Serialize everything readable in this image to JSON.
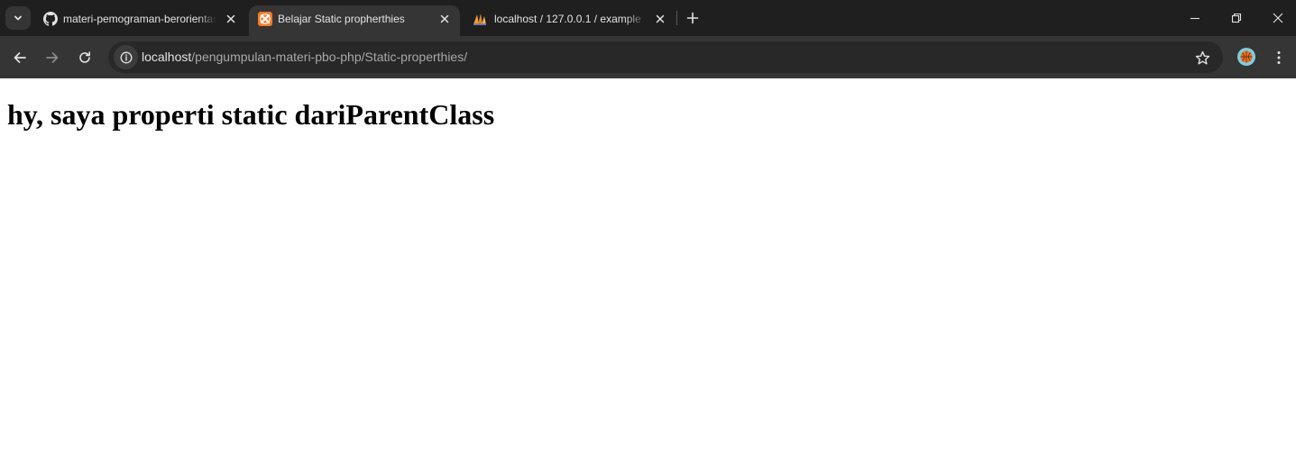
{
  "tabs": [
    {
      "title": "materi-pemograman-berorientasi",
      "favicon": "github-icon",
      "active": false
    },
    {
      "title": "Belajar Static propherthies",
      "favicon": "xampp-icon",
      "active": true
    },
    {
      "title": "localhost / 127.0.0.1 / example",
      "favicon": "phpmyadmin-icon",
      "active": false
    }
  ],
  "address_bar": {
    "host": "localhost",
    "path": "/pengumpulan-materi-pbo-php/Static-properthies/"
  },
  "page": {
    "heading": "hy, saya properti static dariParentClass"
  },
  "colors": {
    "tabstrip_bg": "#1f1f1f",
    "toolbar_bg": "#353535",
    "omnibox_bg": "#282828",
    "xampp_orange": "#fb7a24",
    "page_bg": "#ffffff"
  }
}
